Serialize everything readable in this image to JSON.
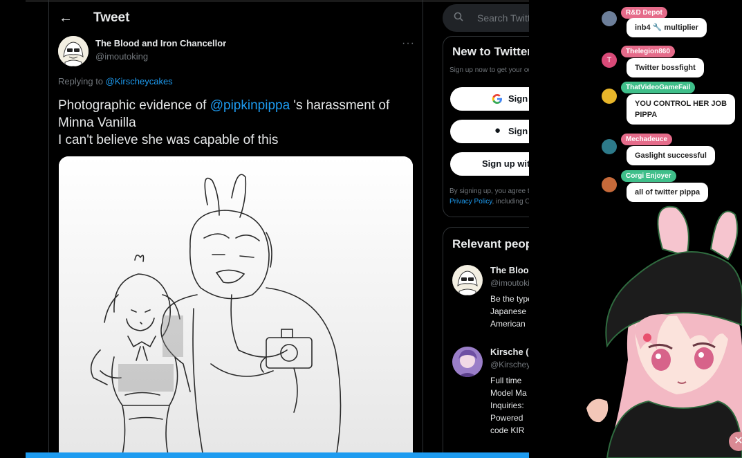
{
  "header": {
    "back_glyph": "←",
    "title": "Tweet"
  },
  "tweet": {
    "author_name": "The Blood and Iron Chancellor",
    "author_handle": "@imoutoking",
    "more_glyph": "···",
    "replying_prefix": "Replying to",
    "replying_to": "@Kirscheycakes",
    "text_pre": "Photographic evidence of",
    "text_mention": "@pipkinpippa",
    "text_post": "'s harassment of Minna Vanilla",
    "text_line2": "I can't believe she was capable of this"
  },
  "sidebar": {
    "search_placeholder": "Search Twitter",
    "signup_card": {
      "title": "New to Twitter?",
      "subtitle": "Sign up now to get your own personalized timeline!",
      "google_label": "Sign up with Google",
      "apple_label": "Sign up with Apple",
      "phone_label": "Sign up with phone or email",
      "legal_line1": "By signing up, you agree to the Terms of Service and",
      "legal_link": "Privacy Policy",
      "legal_line2": ", including Cookie Use."
    },
    "relevant": {
      "title": "Relevant people",
      "people": [
        {
          "name": "The Blood and Iron Chancellor",
          "handle": "@imoutoking",
          "bio": [
            "Be the type of",
            "Japanese",
            "American"
          ]
        },
        {
          "name": "Kirsche (",
          "handle": "@Kirscheycakes",
          "bio": [
            "Full time",
            "Model Ma",
            "Inquiries:",
            "Powered",
            "code KIR"
          ]
        }
      ]
    }
  },
  "chat": {
    "messages": [
      {
        "user": "R&D Depot",
        "text": "inb4 🔧 multiplier",
        "badge_color": "#e56b8a"
      },
      {
        "user": "Thelegion860",
        "text": "Twitter bossfight",
        "badge_color": "#e56b8a"
      },
      {
        "user": "ThatVideoGameFail",
        "text": "YOU CONTROL HER JOB",
        "text2": "PIPPA",
        "badge_color": "#3fbf8a"
      },
      {
        "user": "Mechadeuce",
        "text": "Gaslight successful",
        "badge_color": "#e56b8a"
      },
      {
        "user": "Corgi Enjoyer",
        "text": "all of twitter pippa",
        "badge_color": "#3fbf8a"
      }
    ]
  },
  "colors": {
    "accent": "#1d9bf0",
    "bg": "#000000",
    "chat_pink": "#e56b8a",
    "chat_green": "#3fbf8a"
  }
}
